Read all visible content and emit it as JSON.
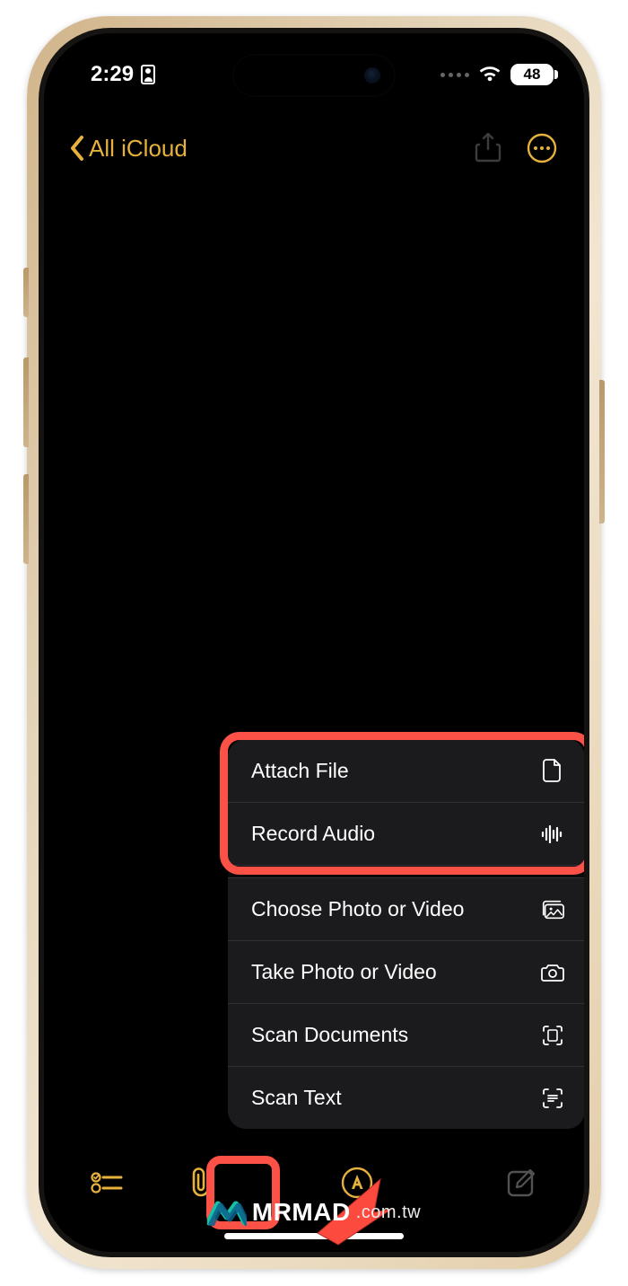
{
  "status": {
    "time": "2:29",
    "battery": "48"
  },
  "nav": {
    "back_label": "All iCloud"
  },
  "menu": {
    "attach_file": "Attach File",
    "record_audio": "Record Audio",
    "choose_photo_video": "Choose Photo or Video",
    "take_photo_video": "Take Photo or Video",
    "scan_documents": "Scan Documents",
    "scan_text": "Scan Text"
  },
  "watermark": {
    "main": "MRMAD",
    "sub": ".com.tw"
  },
  "colors": {
    "accent": "#e7b13d",
    "highlight": "#fc5147"
  }
}
